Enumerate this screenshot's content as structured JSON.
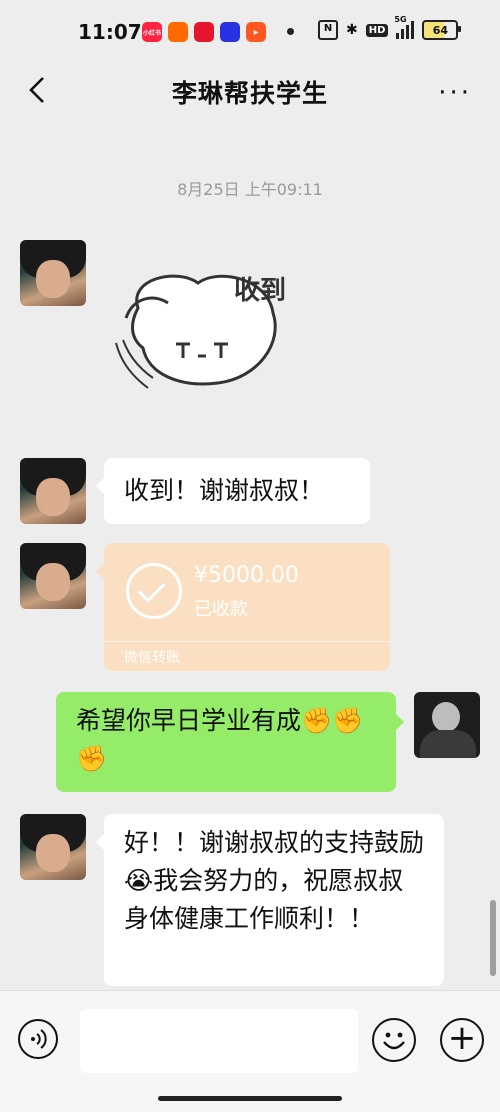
{
  "status_bar": {
    "time": "11:07",
    "network": "5G",
    "hd": "HD",
    "battery": "64",
    "app_icons": [
      {
        "name": "xiaohongshu-icon",
        "color": "#ff2442",
        "label": "小红书"
      },
      {
        "name": "app-icon",
        "color": "#ff6a00",
        "label": ""
      },
      {
        "name": "weibo-icon",
        "color": "#e6162d",
        "label": ""
      },
      {
        "name": "baidu-icon",
        "color": "#2932e1",
        "label": ""
      },
      {
        "name": "video-app-icon",
        "color": "#ff5722",
        "label": ""
      }
    ]
  },
  "nav": {
    "title": "李琳帮扶学生",
    "more": "···"
  },
  "chat": {
    "timestamp": "8月25日 上午09:11",
    "sticker_text": "收到",
    "messages": [
      {
        "text": "收到！谢谢叔叔！"
      },
      {
        "text": "希望你早日学业有成✊✊✊"
      },
      {
        "text": "好！！谢谢叔叔的支持鼓励😭我会努力的，祝愿叔叔身体健康工作顺利！！"
      }
    ],
    "transfer": {
      "amount": "¥5000.00",
      "status": "已收款",
      "footer": "微信转账"
    }
  },
  "colors": {
    "background": "#ededed",
    "green_bubble": "#95ec69",
    "transfer_bubble": "#fbdfc3"
  },
  "input": {
    "placeholder": ""
  }
}
